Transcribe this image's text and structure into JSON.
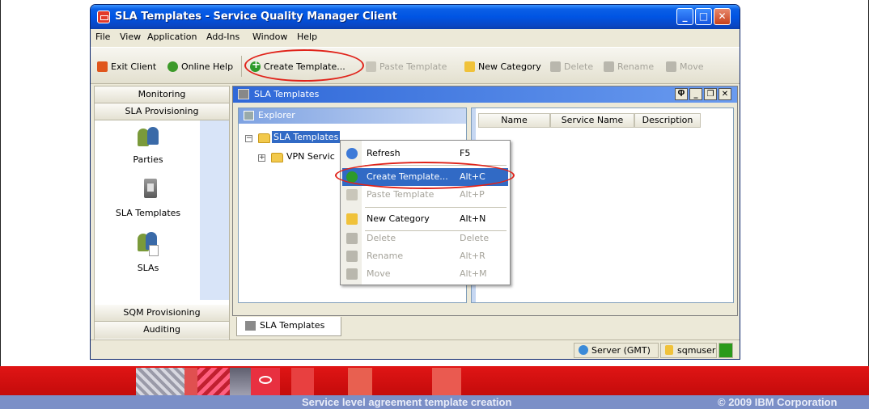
{
  "window": {
    "title": "SLA Templates - Service Quality Manager Client",
    "controls": {
      "minimize": "_",
      "maximize": "□",
      "close": "✕"
    }
  },
  "menubar": [
    "File",
    "View",
    "Application",
    "Add-Ins",
    "Window",
    "Help"
  ],
  "toolbar": {
    "exit": "Exit Client",
    "help": "Online Help",
    "create_template": "Create Template...",
    "paste_template": "Paste Template",
    "new_category": "New Category",
    "delete": "Delete",
    "rename": "Rename",
    "move": "Move"
  },
  "leftnav": {
    "sections": [
      "Monitoring",
      "SLA Provisioning",
      "SQM Provisioning",
      "Auditing"
    ],
    "items": [
      "Parties",
      "SLA Templates",
      "SLAs"
    ]
  },
  "mdi": {
    "title": "SLA Templates",
    "controls": {
      "pin": "Ⴔ",
      "minimize": "_",
      "restore": "❐",
      "close": "✕"
    }
  },
  "explorer": {
    "title": "Explorer",
    "root": "SLA Templates",
    "child": "VPN Servic"
  },
  "table": {
    "columns": [
      "Name",
      "Service Name",
      "Description"
    ]
  },
  "context_menu": {
    "items": [
      {
        "label": "Refresh",
        "shortcut": "F5"
      },
      {
        "label": "Create Template...",
        "shortcut": "Alt+C"
      },
      {
        "label": "Paste Template",
        "shortcut": "Alt+P"
      },
      {
        "label": "New Category",
        "shortcut": "Alt+N"
      },
      {
        "label": "Delete",
        "shortcut": "Delete"
      },
      {
        "label": "Rename",
        "shortcut": "Alt+R"
      },
      {
        "label": "Move",
        "shortcut": "Alt+M"
      }
    ]
  },
  "bottom_tab": "SLA Templates",
  "status": {
    "server": "Server (GMT)",
    "user": "sqmuser"
  },
  "footer": {
    "caption": "Service level agreement template creation",
    "copyright": "© 2009 IBM Corporation"
  },
  "colors": {
    "title_blue": "#0054e3",
    "selection_blue": "#316ac5",
    "annotation_red": "#e0231a",
    "banner_red": "#d01010",
    "banner_blue": "#7b8fc7"
  }
}
